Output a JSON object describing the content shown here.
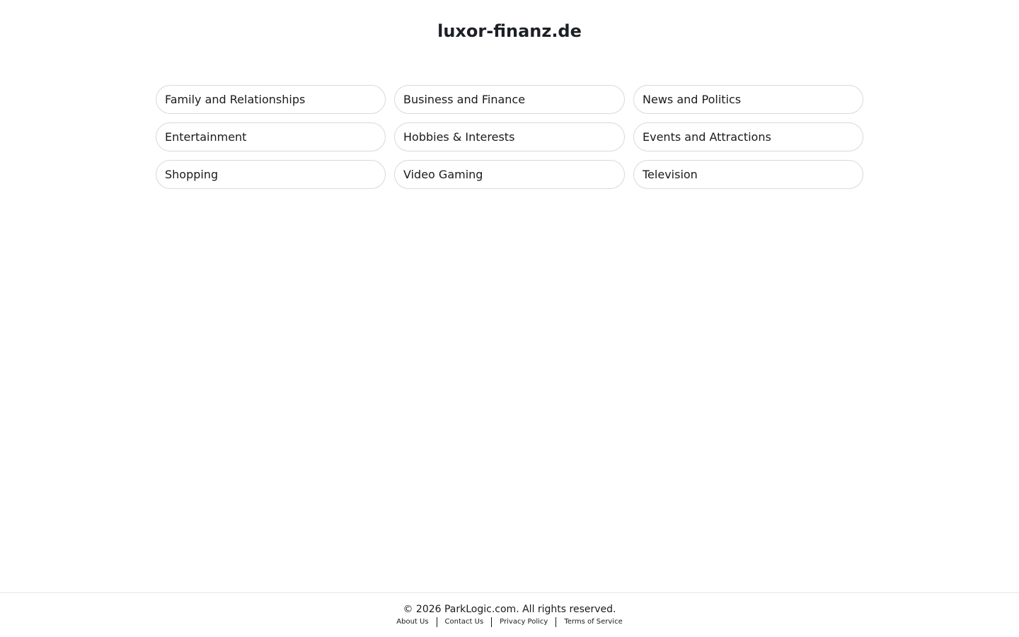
{
  "header": {
    "title": "luxor-finanz.de"
  },
  "links": [
    "Family and Relationships",
    "Business and Finance",
    "News and Politics",
    "Entertainment",
    "Hobbies & Interests",
    "Events and Attractions",
    "Shopping",
    "Video Gaming",
    "Television"
  ],
  "footer": {
    "copyright": "© 2026 ParkLogic.com. All rights reserved.",
    "links": [
      "About Us",
      "Contact Us",
      "Privacy Policy",
      "Terms of Service"
    ]
  }
}
